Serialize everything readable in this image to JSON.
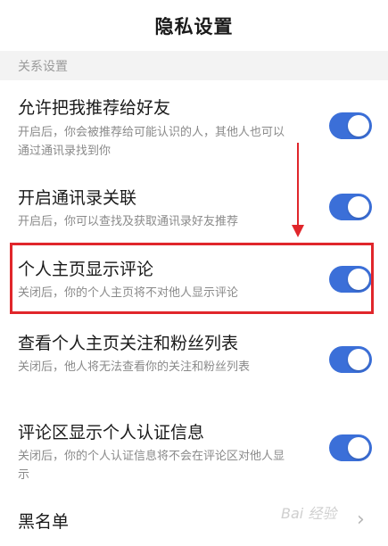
{
  "header": {
    "title": "隐私设置"
  },
  "section": {
    "label": "关系设置"
  },
  "items": [
    {
      "title": "允许把我推荐给好友",
      "desc": "开启后，你会被推荐给可能认识的人，其他人也可以通过通讯录找到你",
      "enabled": true
    },
    {
      "title": "开启通讯录关联",
      "desc": "开启后，你可以查找及获取通讯录好友推荐",
      "enabled": true
    },
    {
      "title": "个人主页显示评论",
      "desc": "关闭后，你的个人主页将不对他人显示评论",
      "enabled": true
    },
    {
      "title": "查看个人主页关注和粉丝列表",
      "desc": "关闭后，他人将无法查看你的关注和粉丝列表",
      "enabled": true
    },
    {
      "title": "评论区显示个人认证信息",
      "desc": "关闭后，你的个人认证信息将不会在评论区对他人显示",
      "enabled": true
    }
  ],
  "blacklist": {
    "label": "黑名单",
    "chevron_icon": "chevron-right-icon"
  },
  "annotation": {
    "box_color": "#e0262b",
    "arrow_color": "#e0262b"
  },
  "watermark": {
    "text": "Bai 经验"
  },
  "colors": {
    "toggle_on": "#3b6fd8"
  }
}
